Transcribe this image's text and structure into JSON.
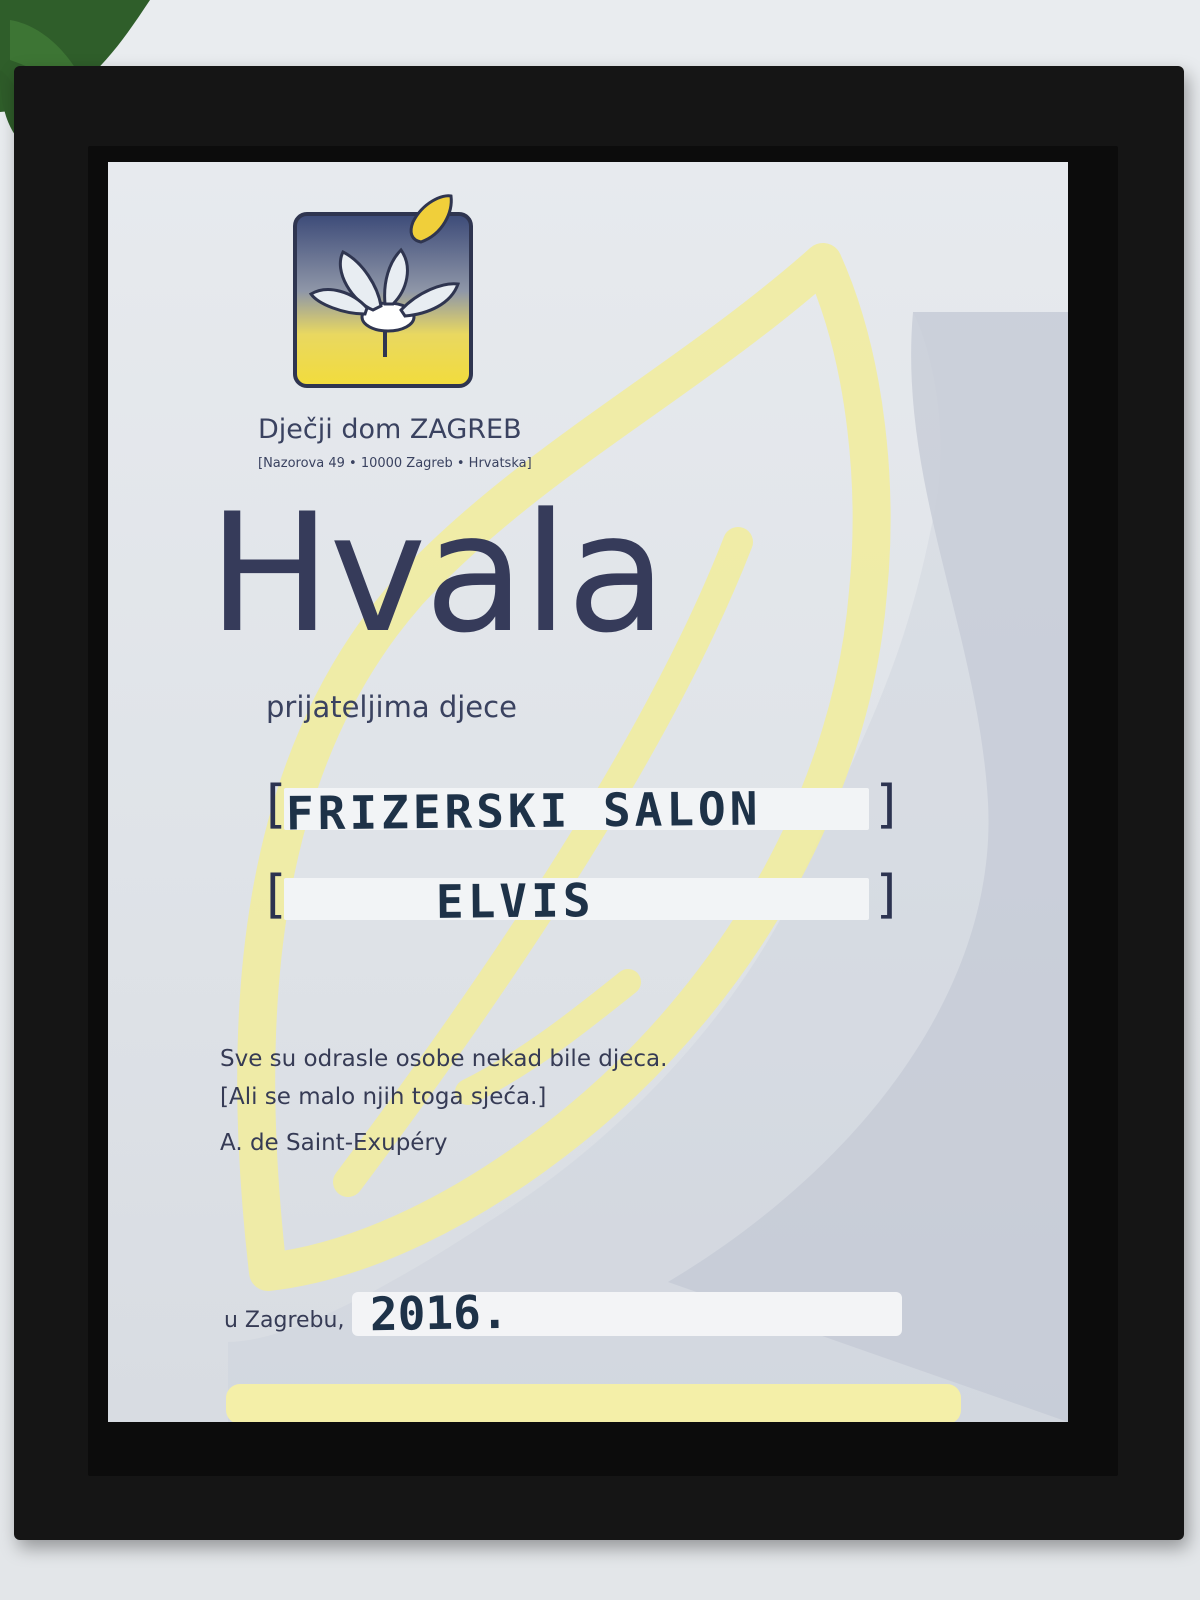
{
  "certificate": {
    "org_name": "Dječji dom ZAGREB",
    "org_address": "[Nazorova 49 • 10000 Zagreb • Hrvatska]",
    "title": "Hvala",
    "subtitle": "prijateljima djece",
    "recipient_line1": "FRIZERSKI SALON",
    "recipient_line2": "ELVIS",
    "quote_line1": "Sve su odrasle osobe nekad bile djeca.",
    "quote_line2": "[Ali se malo njih toga sjeća.]",
    "quote_author": "A. de Saint-Exupéry",
    "place_label": "u Zagrebu,",
    "date": "2016."
  },
  "colors": {
    "frame": "#151515",
    "paper": "#e5e8ec",
    "navy_text": "#363b5a",
    "leaf_yellow": "#f3eea4",
    "leaf_grey": "#b7bdcc",
    "handwriting_ink": "#1e3248"
  }
}
